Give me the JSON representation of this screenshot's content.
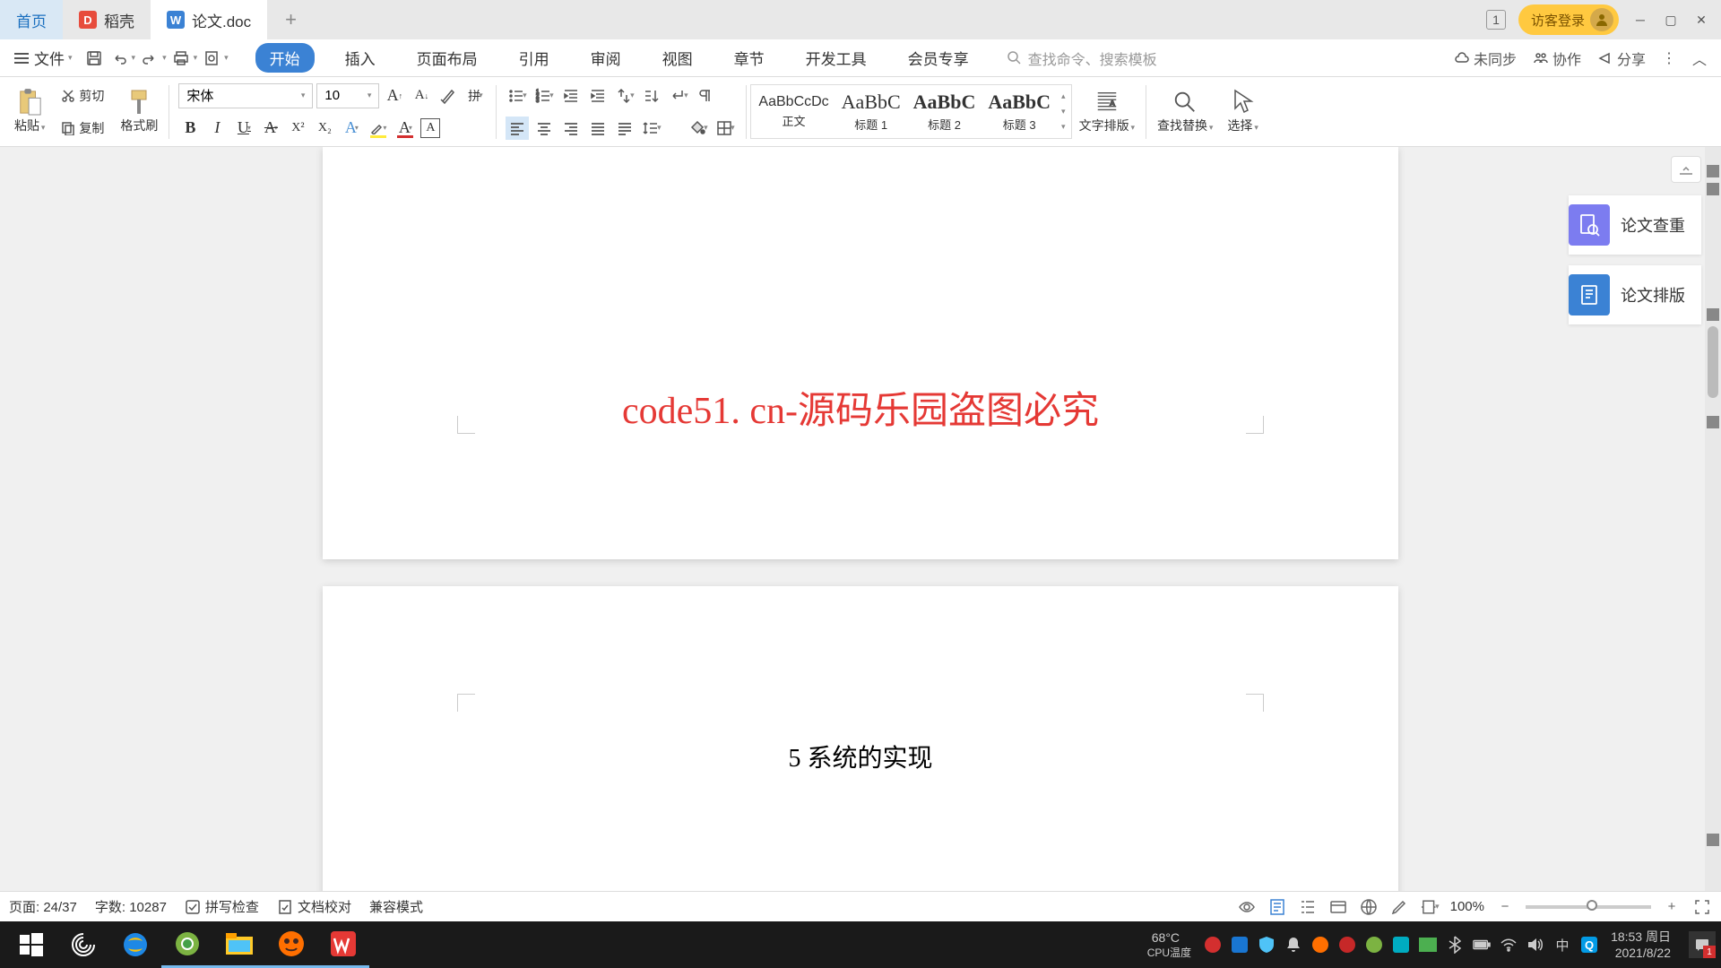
{
  "watermark_text": "code51.cn",
  "titlebar": {
    "tabs": {
      "home": "首页",
      "daoke": "稻壳",
      "document": "论文.doc"
    },
    "num_indicator": "1",
    "login": "访客登录"
  },
  "menubar": {
    "file": "文件",
    "tabs": {
      "start": "开始",
      "insert": "插入",
      "pagelayout": "页面布局",
      "reference": "引用",
      "review": "审阅",
      "view": "视图",
      "chapter": "章节",
      "devtools": "开发工具",
      "member": "会员专享"
    },
    "search_placeholder": "查找命令、搜索模板",
    "right": {
      "sync": "未同步",
      "collab": "协作",
      "share": "分享"
    }
  },
  "ribbon": {
    "paste": "粘贴",
    "cut": "剪切",
    "copy": "复制",
    "format_painter": "格式刷",
    "font_name": "宋体",
    "font_size": "10",
    "styles": {
      "normal_preview": "AaBbCcDc",
      "normal": "正文",
      "h1_preview": "AaBbC",
      "h1": "标题 1",
      "h2_preview": "AaBbC",
      "h2": "标题 2",
      "h3_preview": "AaBbC",
      "h3": "标题 3"
    },
    "text_layout": "文字排版",
    "find_replace": "查找替换",
    "select": "选择"
  },
  "side_panel": {
    "check": "论文查重",
    "layout": "论文排版"
  },
  "document": {
    "red_text": "code51. cn-源码乐园盗图必究",
    "heading": "5  系统的实现"
  },
  "statusbar": {
    "page": "页面: 24/37",
    "words": "字数: 10287",
    "spellcheck": "拼写检查",
    "doccheck": "文档校对",
    "compat": "兼容模式",
    "zoom": "100%"
  },
  "taskbar": {
    "temp_val": "68°C",
    "temp_label": "CPU温度",
    "ime": "中",
    "time": "18:53 周日",
    "date": "2021/8/22",
    "notif_count": "1"
  }
}
